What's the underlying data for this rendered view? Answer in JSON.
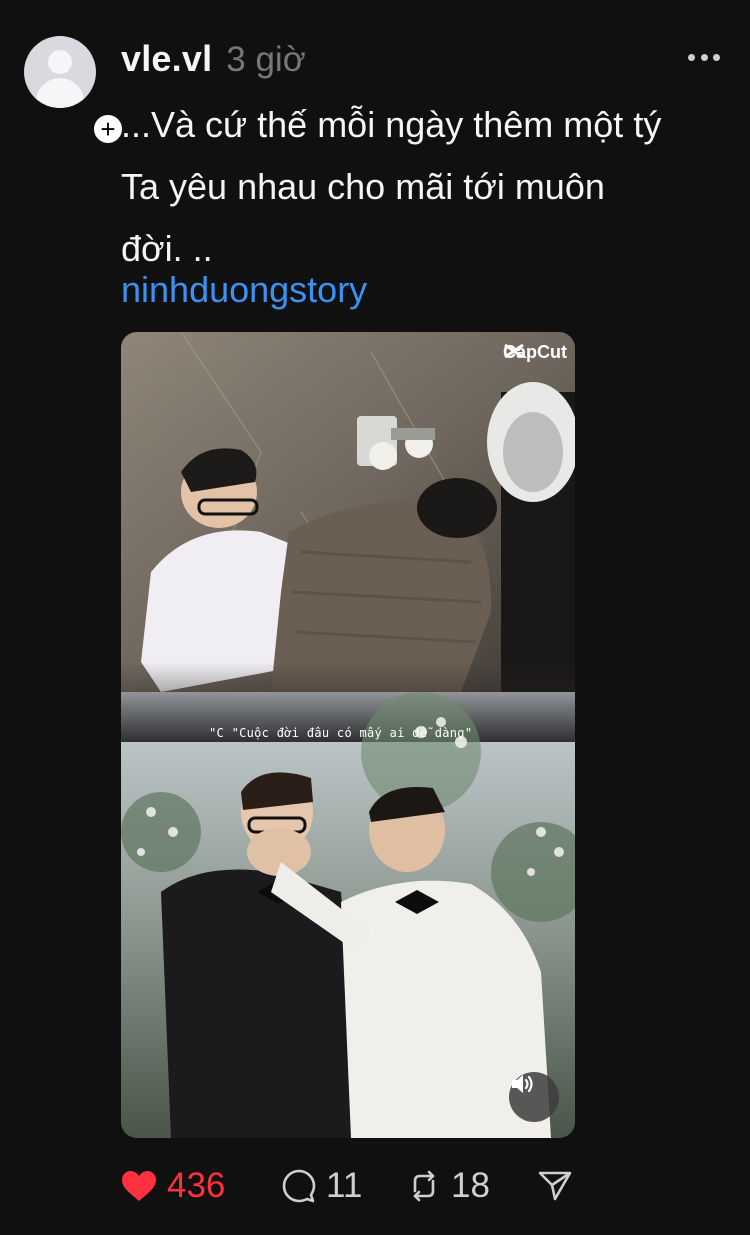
{
  "post": {
    "username": "vle.vl",
    "timestamp": "3 giờ",
    "caption_lines": [
      "...Và cứ thế mỗi ngày thêm một tý",
      "Ta yêu nhau cho mãi tới muôn",
      "đời. .."
    ],
    "hashtag": "ninhduongstory",
    "media": {
      "watermark": "CapCut",
      "overlay_text": "\"C \"Cuộc đời đâu có mấy ai dễ dàng\""
    },
    "actions": {
      "likes": "436",
      "comments": "11",
      "reposts": "18"
    }
  },
  "colors": {
    "background": "#101010",
    "text": "#f3f5f7",
    "muted": "#777777",
    "link": "#3b92f5",
    "like": "#ff3040"
  },
  "icons": [
    "avatar-placeholder",
    "plus-icon",
    "more-icon",
    "capcut-icon",
    "volume-icon",
    "heart-icon",
    "comment-icon",
    "repost-icon",
    "send-icon"
  ]
}
